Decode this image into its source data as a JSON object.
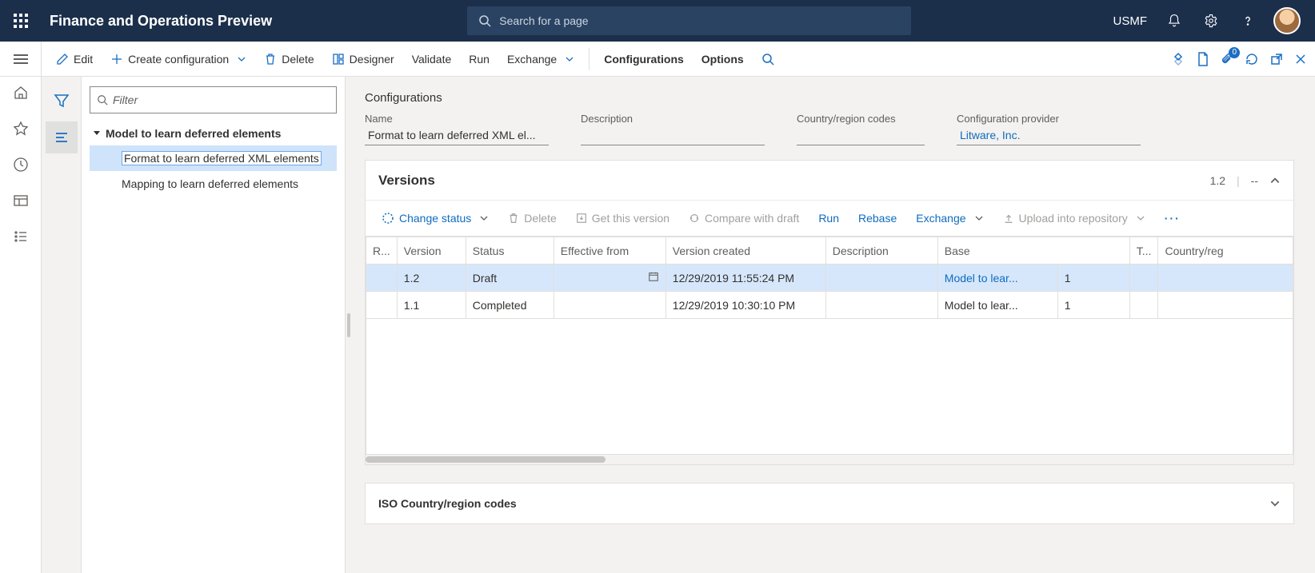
{
  "header": {
    "brand": "Finance and Operations Preview",
    "search_placeholder": "Search for a page",
    "company": "USMF",
    "attachments_badge": "0"
  },
  "actions": {
    "edit": "Edit",
    "create": "Create configuration",
    "delete": "Delete",
    "designer": "Designer",
    "validate": "Validate",
    "run": "Run",
    "exchange": "Exchange",
    "configurations": "Configurations",
    "options": "Options"
  },
  "tree": {
    "filter_placeholder": "Filter",
    "root": "Model to learn deferred elements",
    "children": [
      "Format to learn deferred XML elements",
      "Mapping to learn deferred elements"
    ],
    "selected_index": 0
  },
  "page": {
    "title": "Configurations",
    "fields": {
      "name_label": "Name",
      "name_value": "Format to learn deferred XML el...",
      "desc_label": "Description",
      "desc_value": "",
      "crc_label": "Country/region codes",
      "crc_value": "",
      "prov_label": "Configuration provider",
      "prov_value": "Litware, Inc."
    }
  },
  "versions": {
    "title": "Versions",
    "current": "1.2",
    "dash": "--",
    "toolbar": {
      "change_status": "Change status",
      "delete": "Delete",
      "get": "Get this version",
      "compare": "Compare with draft",
      "run": "Run",
      "rebase": "Rebase",
      "exchange": "Exchange",
      "upload": "Upload into repository"
    },
    "columns": {
      "r": "R...",
      "version": "Version",
      "status": "Status",
      "eff": "Effective from",
      "created": "Version created",
      "desc": "Description",
      "base": "Base",
      "t": "T...",
      "cr": "Country/reg"
    },
    "rows": [
      {
        "version": "1.2",
        "status": "Draft",
        "eff": "",
        "created": "12/29/2019 11:55:24 PM",
        "desc": "",
        "base": "Model to lear...",
        "baseNum": "1",
        "selected": true
      },
      {
        "version": "1.1",
        "status": "Completed",
        "eff": "",
        "created": "12/29/2019 10:30:10 PM",
        "desc": "",
        "base": "Model to lear...",
        "baseNum": "1",
        "selected": false
      }
    ]
  },
  "iso": {
    "title": "ISO Country/region codes"
  }
}
